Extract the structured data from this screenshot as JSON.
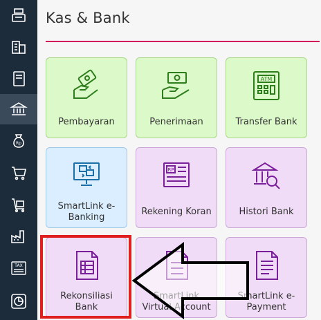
{
  "page": {
    "title": "Kas & Bank"
  },
  "sidebar": {
    "items": [
      {
        "icon": "cash-register-icon"
      },
      {
        "icon": "building-icon"
      },
      {
        "icon": "book-icon"
      },
      {
        "icon": "bank-icon",
        "active": true
      },
      {
        "icon": "money-bag-icon"
      },
      {
        "icon": "shopping-cart-icon"
      },
      {
        "icon": "cart-box-icon"
      },
      {
        "icon": "factory-icon"
      },
      {
        "icon": "tax-icon"
      },
      {
        "icon": "pie-chart-icon"
      }
    ]
  },
  "tiles": [
    {
      "label": "Pembayaran",
      "icon": "payment-hand-icon"
    },
    {
      "label": "Penerimaan",
      "icon": "receive-money-icon"
    },
    {
      "label": "Transfer Bank",
      "icon": "atm-icon"
    },
    {
      "label": "SmartLink e-Banking",
      "icon": "smartlink-computer-icon"
    },
    {
      "label": "Rekening Koran",
      "icon": "bank-statement-icon"
    },
    {
      "label": "Histori Bank",
      "icon": "bank-search-icon"
    },
    {
      "label": "Rekonsiliasi Bank",
      "icon": "reconcile-document-icon"
    },
    {
      "label": "SmartLink Virtual Account",
      "icon": "virtual-account-icon"
    },
    {
      "label": "SmartLink e-Payment",
      "icon": "e-payment-icon"
    }
  ],
  "icon_text": {
    "atm": "ATM",
    "rp": "RP",
    "rp_small": "Rp",
    "tax": "TAX"
  },
  "colors": {
    "accent": "#d2195a",
    "green_tile": "#dcf9c9",
    "blue_tile": "#dbeeff",
    "purple_tile": "#f1dcf7",
    "highlight": "#e02020",
    "sidebar": "#1d2c3a"
  }
}
